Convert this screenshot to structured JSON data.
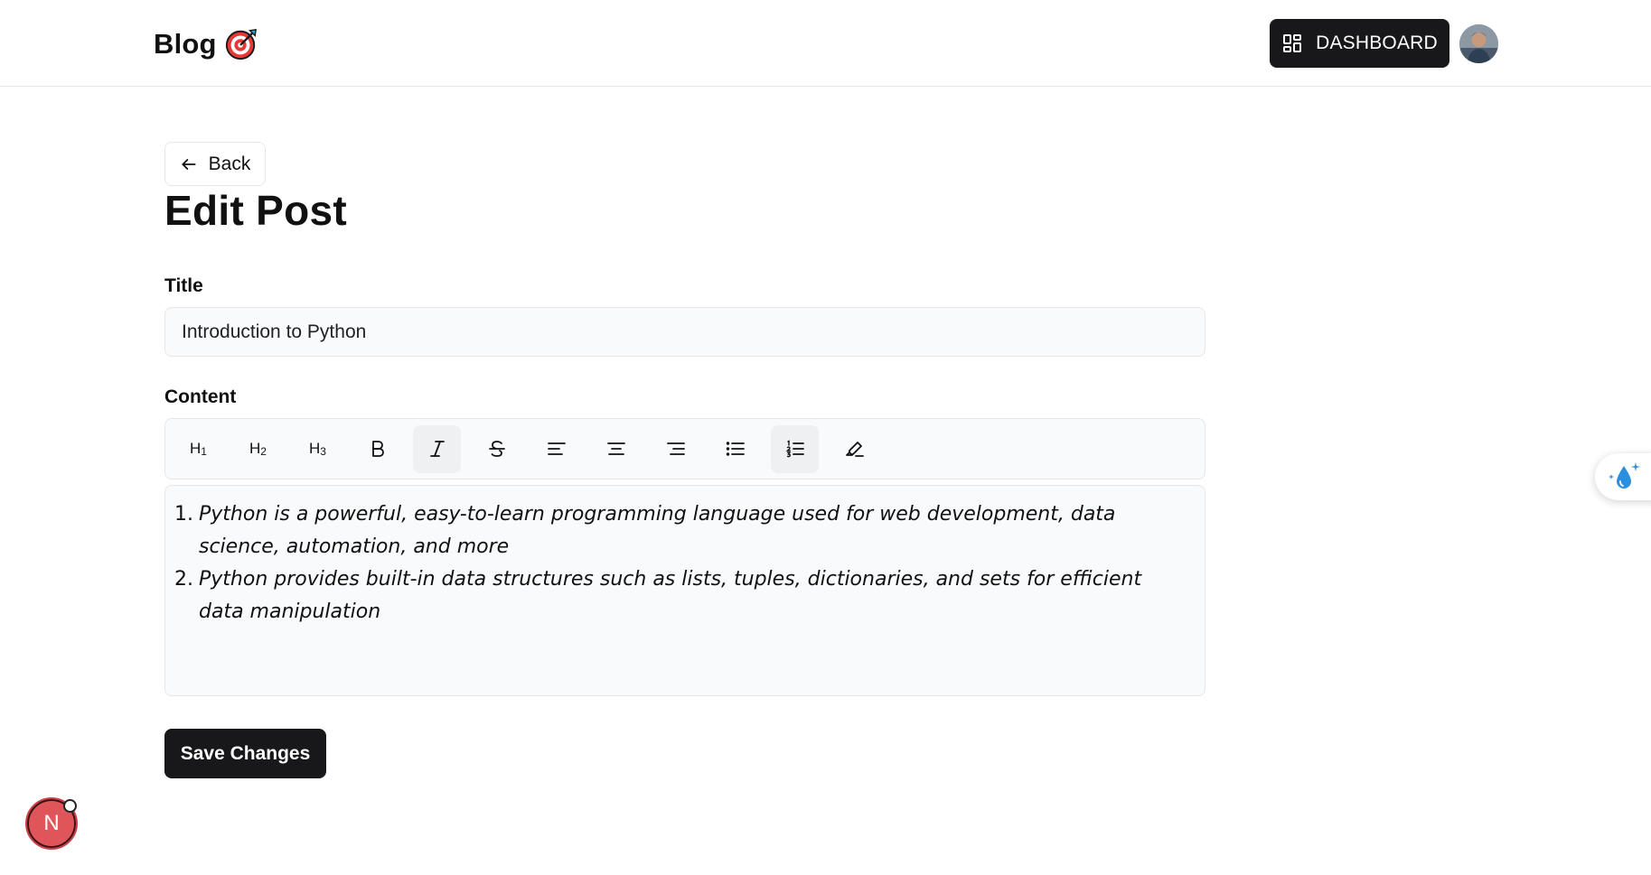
{
  "header": {
    "brand": "Blog",
    "brand_icon": "target-logo-icon",
    "dashboard_label": "DASHBOARD",
    "dashboard_icon": "grid-icon",
    "avatar_icon": "user-avatar"
  },
  "main": {
    "back_label": "Back",
    "back_icon": "arrow-left-icon",
    "page_title": "Edit Post",
    "title_label": "Title",
    "title_value": "Introduction to Python",
    "content_label": "Content",
    "toolbar": [
      {
        "name": "heading-1-button",
        "label": "H",
        "sub": "1",
        "active": false
      },
      {
        "name": "heading-2-button",
        "label": "H",
        "sub": "2",
        "active": false
      },
      {
        "name": "heading-3-button",
        "label": "H",
        "sub": "3",
        "active": false
      },
      {
        "name": "bold-button",
        "icon": "bold-icon",
        "active": false
      },
      {
        "name": "italic-button",
        "icon": "italic-icon",
        "active": true
      },
      {
        "name": "strikethrough-button",
        "icon": "strikethrough-icon",
        "active": false
      },
      {
        "name": "align-left-button",
        "icon": "align-left-icon",
        "active": false
      },
      {
        "name": "align-center-button",
        "icon": "align-center-icon",
        "active": false
      },
      {
        "name": "align-right-button",
        "icon": "align-right-icon",
        "active": false
      },
      {
        "name": "bullet-list-button",
        "icon": "bullet-list-icon",
        "active": false
      },
      {
        "name": "ordered-list-button",
        "icon": "ordered-list-icon",
        "active": true
      },
      {
        "name": "highlight-button",
        "icon": "highlighter-icon",
        "active": false
      }
    ],
    "content_items": [
      {
        "num": "1.",
        "text": "Python is a powerful, easy-to-learn programming language used for web development, data science, automation, and more"
      },
      {
        "num": "2.",
        "text": "Python provides built-in data structures such as lists, tuples, dictionaries, and sets for efficient data manipulation"
      }
    ],
    "save_label": "Save Changes"
  },
  "overlays": {
    "side_widget_icon": "water-drop-sparkle-icon",
    "dev_badge_label": "N"
  },
  "colors": {
    "primary_button": "#18181b",
    "input_bg": "#f9fafb",
    "border": "#e5e7eb",
    "badge_red": "#e0555a"
  }
}
